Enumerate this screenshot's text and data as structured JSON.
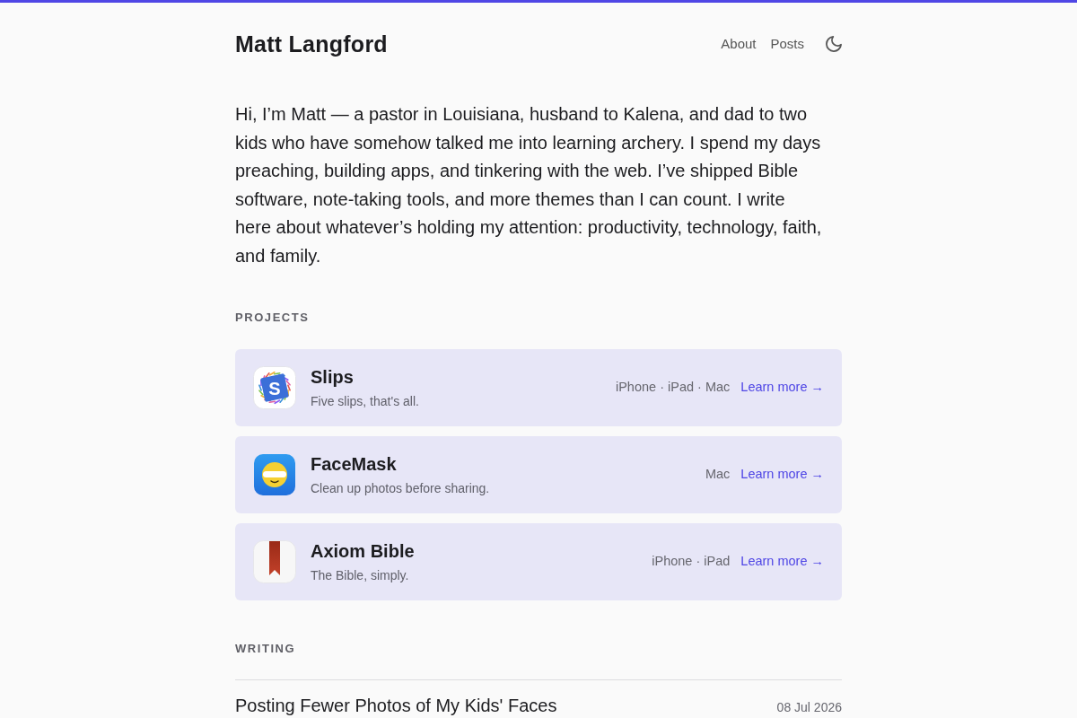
{
  "header": {
    "site_title": "Matt Langford",
    "nav": [
      {
        "label": "About"
      },
      {
        "label": "Posts"
      }
    ]
  },
  "intro": "Hi, I’m Matt — a pastor in Louisiana, husband to Kalena, and dad to two kids who have somehow talked me into learning archery. I spend my days preaching, building apps, and tinkering with the web. I’ve shipped Bible software, note-taking tools, and more themes than I can count. I write here about whatever’s holding my attention: productivity, technology, faith, and family.",
  "projects": {
    "heading": "PROJECTS",
    "items": [
      {
        "name": "Slips",
        "icon_letter": "S",
        "tagline": "Five slips, that's all.",
        "platforms": "iPhone · iPad · Mac",
        "link": "Learn more →"
      },
      {
        "name": "FaceMask",
        "tagline": "Clean up photos before sharing.",
        "platforms": "Mac",
        "link": "Learn more →"
      },
      {
        "name": "Axiom Bible",
        "tagline": "The Bible, simply.",
        "platforms": "iPhone · iPad",
        "link": "Learn more →"
      }
    ]
  },
  "writing": {
    "heading": "WRITING",
    "posts": [
      {
        "title": "Posting Fewer Photos of My Kids' Faces",
        "date": "08 Jul 2026"
      }
    ]
  }
}
